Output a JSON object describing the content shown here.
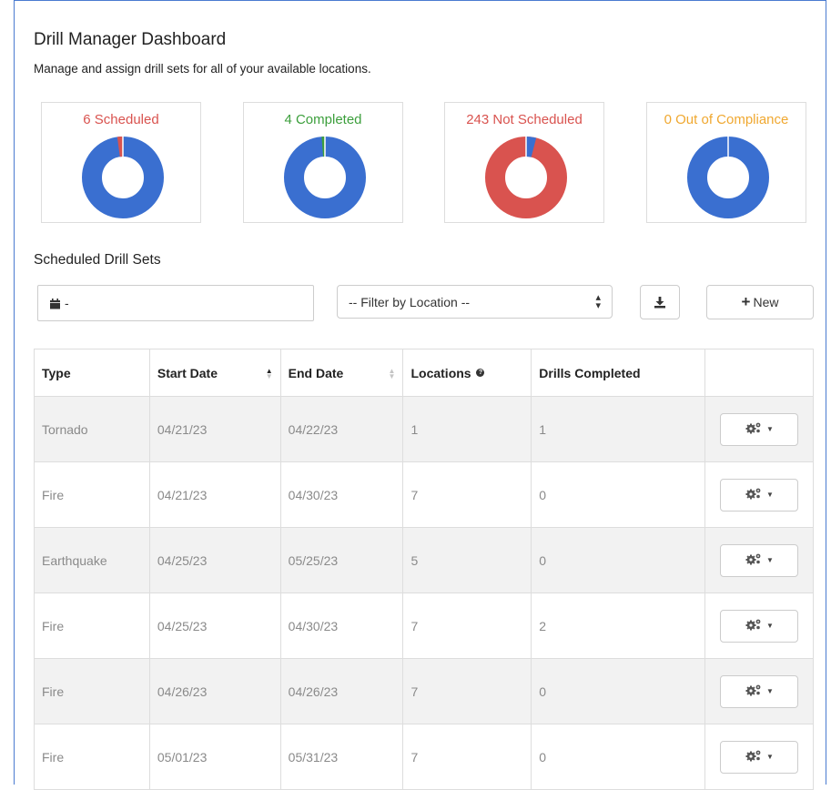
{
  "header": {
    "title": "Drill Manager Dashboard",
    "subtitle": "Manage and assign drill sets for all of your available locations."
  },
  "cards": [
    {
      "label": "6 Scheduled",
      "count": 6,
      "color": "#d9534f"
    },
    {
      "label": "4 Completed",
      "count": 4,
      "color": "#3c9f3c"
    },
    {
      "label": "243 Not Scheduled",
      "count": 243,
      "color": "#d9534f"
    },
    {
      "label": "0 Out of Compliance",
      "count": 0,
      "color": "#f0a830"
    }
  ],
  "donut_colors": {
    "primary": "#3a6fd0",
    "not_scheduled": "#d9534f",
    "small_slice": "#d9534f"
  },
  "section": {
    "title": "Scheduled Drill Sets"
  },
  "filters": {
    "date_value": "-",
    "location_selected": "-- Filter by Location --"
  },
  "toolbar": {
    "new_label": "New"
  },
  "table": {
    "headers": [
      "Type",
      "Start Date",
      "End Date",
      "Locations",
      "Drills Completed"
    ],
    "rows": [
      [
        "Tornado",
        "04/21/23",
        "04/22/23",
        "1",
        "1"
      ],
      [
        "Fire",
        "04/21/23",
        "04/30/23",
        "7",
        "0"
      ],
      [
        "Earthquake",
        "04/25/23",
        "05/25/23",
        "5",
        "0"
      ],
      [
        "Fire",
        "04/25/23",
        "04/30/23",
        "7",
        "2"
      ],
      [
        "Fire",
        "04/26/23",
        "04/26/23",
        "7",
        "0"
      ],
      [
        "Fire",
        "05/01/23",
        "05/31/23",
        "7",
        "0"
      ]
    ]
  },
  "icons": {
    "date": "calendar-icon",
    "download": "download-icon",
    "add": "plus-icon",
    "actions": "gears-icon",
    "info": "question-circle-icon"
  }
}
